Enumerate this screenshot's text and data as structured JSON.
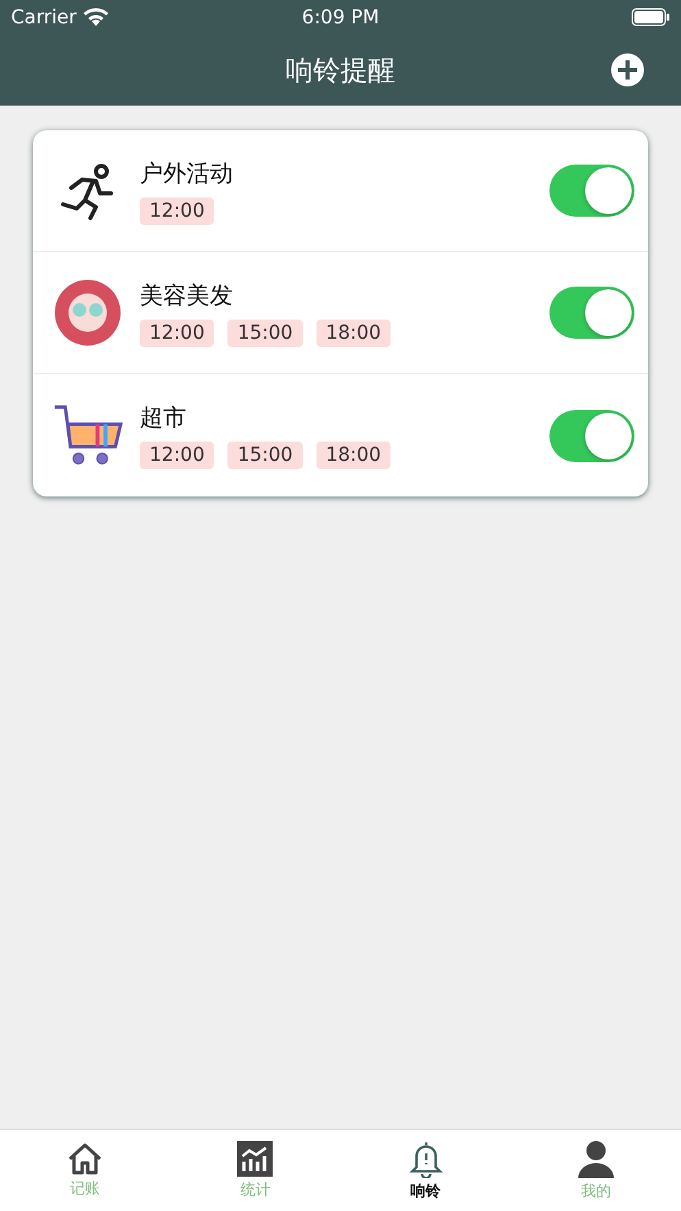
{
  "status_bar": {
    "carrier": "Carrier",
    "time": "6:09 PM"
  },
  "nav": {
    "title": "响铃提醒"
  },
  "reminders": [
    {
      "kind": "runner",
      "name": "户外活动",
      "times": [
        "12:00"
      ],
      "on": true
    },
    {
      "kind": "beauty",
      "name": "美容美发",
      "times": [
        "12:00",
        "15:00",
        "18:00"
      ],
      "on": true
    },
    {
      "kind": "cart",
      "name": "超市",
      "times": [
        "12:00",
        "15:00",
        "18:00"
      ],
      "on": true
    }
  ],
  "tabs": [
    {
      "kind": "home",
      "label": "记账",
      "selected": false
    },
    {
      "kind": "chart",
      "label": "统计",
      "selected": false
    },
    {
      "kind": "bell",
      "label": "响铃",
      "selected": true
    },
    {
      "kind": "person",
      "label": "我的",
      "selected": false
    }
  ]
}
